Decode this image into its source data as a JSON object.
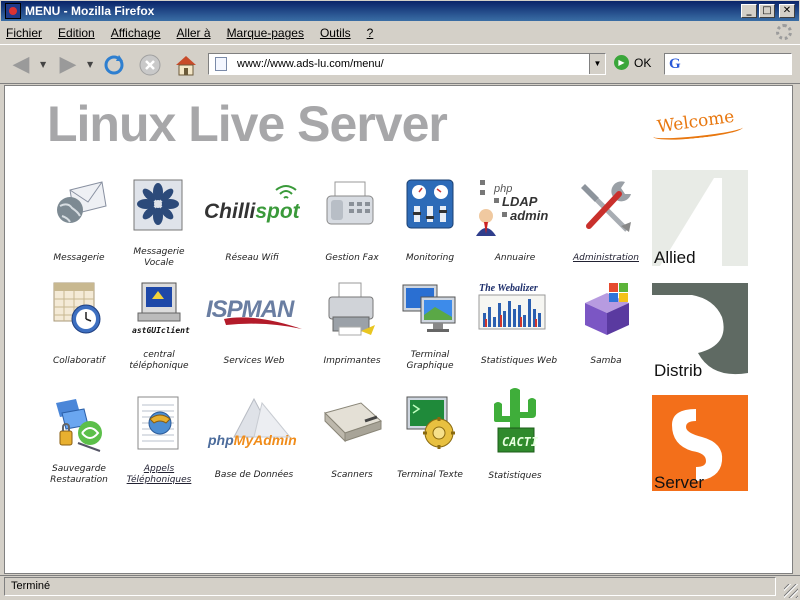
{
  "window": {
    "title": "MENU - Mozilla Firefox"
  },
  "menubar": [
    "Fichier",
    "Edition",
    "Affichage",
    "Aller à",
    "Marque-pages",
    "Outils",
    "?"
  ],
  "toolbar": {
    "url": "www://www.ads-lu.com/menu/",
    "go_label": "OK",
    "search_logo": "G"
  },
  "banner": {
    "title": "Linux Live Server",
    "welcome": "Welcome"
  },
  "brands": [
    {
      "label": "Allied",
      "color": "#e8ebe6"
    },
    {
      "label": "Distrib",
      "color": "#5f6a63"
    },
    {
      "label": "Server",
      "color": "#f36f1a"
    }
  ],
  "apps": {
    "row1": [
      {
        "label": "Messagerie",
        "icon": "mail-globe-icon"
      },
      {
        "label": "Messagerie Vocale",
        "icon": "voice-mail-icon"
      },
      {
        "label": "Réseau Wifi",
        "icon": "chillispot-logo",
        "logo_text": "Chillispot"
      },
      {
        "label": "Gestion Fax",
        "icon": "fax-icon"
      },
      {
        "label": "Monitoring",
        "icon": "monitoring-gauges-icon"
      },
      {
        "label": "Annuaire",
        "icon": "php-ldap-admin-icon",
        "logo_text": "php LDAP admin"
      },
      {
        "label": "Administration",
        "icon": "tools-icon",
        "link": true
      }
    ],
    "row2": [
      {
        "label": "Collaboratif",
        "icon": "calendar-clock-icon"
      },
      {
        "label": "central téléphonique",
        "icon": "asterisk-gui-icon",
        "logo_text": "astGUIclient"
      },
      {
        "label": "Services Web",
        "icon": "isp-man-icon",
        "logo_text": "ISPMAN"
      },
      {
        "label": "Imprimantes",
        "icon": "printer-icon"
      },
      {
        "label": "Terminal Graphique",
        "icon": "remote-desktop-icon"
      },
      {
        "label": "Statistiques Web",
        "icon": "webalizer-chart-icon",
        "logo_text": "The Webalizer"
      },
      {
        "label": "Samba",
        "icon": "samba-box-icon"
      }
    ],
    "row3": [
      {
        "label": "Sauvegarde Restauration",
        "icon": "backup-restore-icon"
      },
      {
        "label": "Appels Téléphoniques",
        "icon": "phone-calls-icon",
        "link": true
      },
      {
        "label": "Base de Données",
        "icon": "phpmyadmin-icon",
        "logo_text": "phpMyAdmin"
      },
      {
        "label": "Scanners",
        "icon": "scanner-icon"
      },
      {
        "label": "Terminal Texte",
        "icon": "text-terminal-icon"
      },
      {
        "label": "Statistiques",
        "icon": "cacti-icon",
        "logo_text": "CACTI"
      }
    ]
  },
  "status": {
    "text": "Terminé"
  },
  "colors": {
    "titlebar": "#0a246a",
    "chrome": "#d4d0c8",
    "banner_gray": "#a7a7a9",
    "welcome_orange": "#e8770f"
  }
}
